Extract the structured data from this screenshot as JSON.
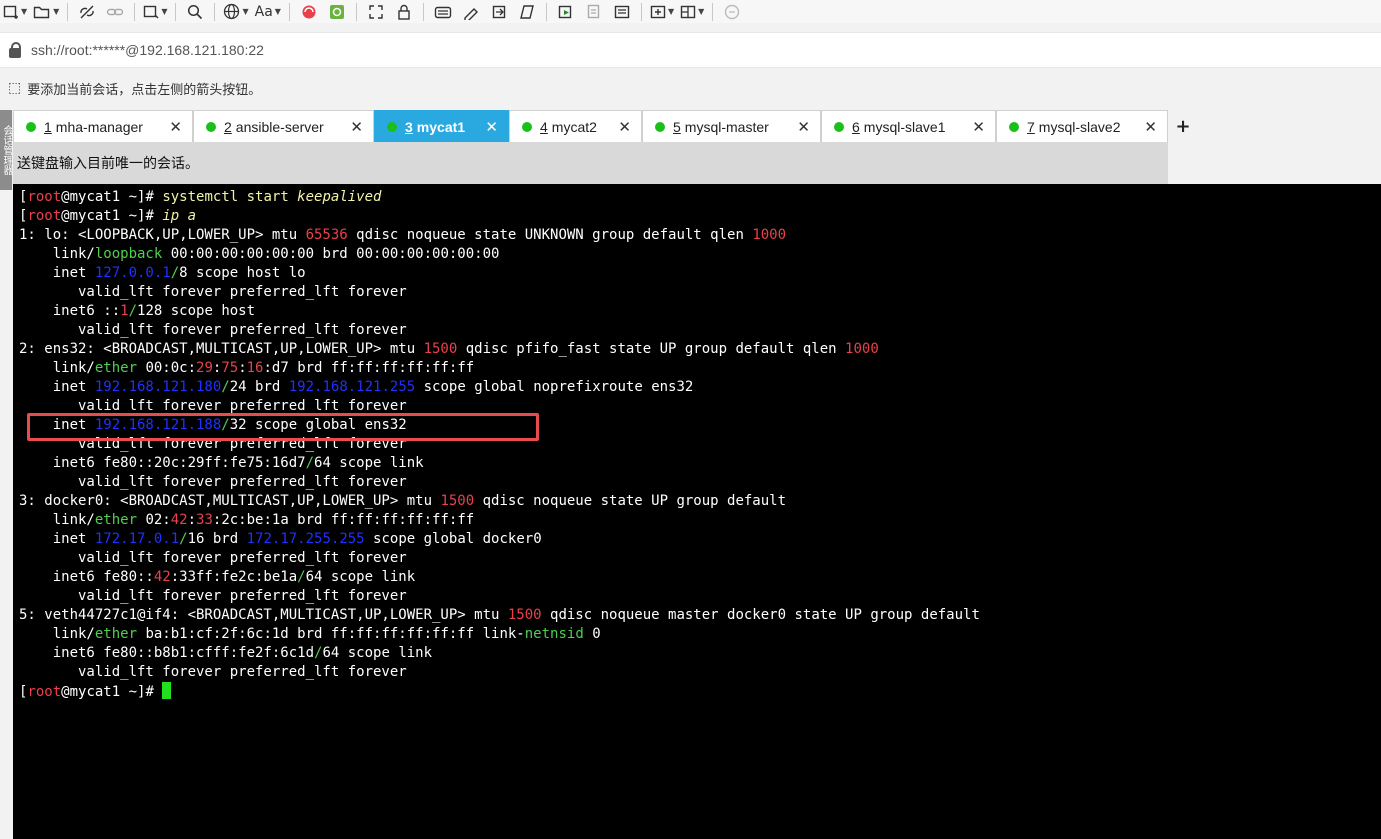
{
  "toolbar": {
    "icons": [
      "new-session-icon",
      "open-folder-icon",
      "disconnect-icon",
      "link-icon",
      "new-window-icon",
      "search-icon",
      "globe-icon",
      "font-icon",
      "app-red-icon",
      "app-green-icon",
      "fullscreen-icon",
      "lock-icon",
      "keyboard-icon",
      "script-icon",
      "transfer-icon",
      "macro-icon",
      "log-icon",
      "record-icon",
      "notes-icon",
      "add-icon",
      "layout-icon",
      "chat-icon"
    ],
    "font_label": "Aa"
  },
  "address": {
    "text": "ssh://root:******@192.168.121.180:22"
  },
  "hint": {
    "text": "要添加当前会话，点击左侧的箭头按钮。"
  },
  "sidebar": {
    "text": "会话管理器"
  },
  "tabs": [
    {
      "num": "1",
      "label": "mha-manager",
      "active": false
    },
    {
      "num": "2",
      "label": "ansible-server",
      "active": false
    },
    {
      "num": "3",
      "label": "mycat1",
      "active": true
    },
    {
      "num": "4",
      "label": "mycat2",
      "active": false
    },
    {
      "num": "5",
      "label": "mysql-master",
      "active": false
    },
    {
      "num": "6",
      "label": "mysql-slave1",
      "active": false
    },
    {
      "num": "7",
      "label": "mysql-slave2",
      "active": false
    }
  ],
  "tab_close": "✕",
  "tab_add": "+",
  "notice": {
    "text": "送键盘输入目前唯一的会话。"
  },
  "terminal": {
    "lines": [
      [
        [
          "[",
          ""
        ],
        [
          "root",
          "r"
        ],
        [
          "@mycat1 ~]# ",
          ""
        ],
        [
          "systemctl start ",
          "y"
        ],
        [
          "keepalived",
          "y i"
        ]
      ],
      [
        [
          "[",
          ""
        ],
        [
          "root",
          "r"
        ],
        [
          "@mycat1 ~]# ",
          ""
        ],
        [
          "ip a",
          "y i"
        ]
      ],
      [
        [
          "1: lo: <LOOPBACK,UP,LOWER_UP> mtu ",
          ""
        ],
        [
          "65536",
          "r"
        ],
        [
          " qdisc noqueue state UNKNOWN group default qlen ",
          ""
        ],
        [
          "1000",
          "r"
        ]
      ],
      [
        [
          "    link/",
          ""
        ],
        [
          "loopback",
          "g"
        ],
        [
          " 00:00:00:00:00:00 brd 00:00:00:00:00:00",
          ""
        ]
      ],
      [
        [
          "    inet ",
          ""
        ],
        [
          "127.0.0.1",
          "b"
        ],
        [
          "/",
          "g"
        ],
        [
          "8",
          ""
        ],
        [
          " scope host lo",
          ""
        ]
      ],
      [
        [
          "       valid_lft forever preferred_lft forever",
          ""
        ]
      ],
      [
        [
          "    inet6 ::",
          ""
        ],
        [
          "1",
          "r"
        ],
        [
          "/",
          "g"
        ],
        [
          "128",
          ""
        ],
        [
          " scope host",
          ""
        ]
      ],
      [
        [
          "       valid_lft forever preferred_lft forever",
          ""
        ]
      ],
      [
        [
          "2: ens32: <BROADCAST,MULTICAST,UP,LOWER_UP> mtu ",
          ""
        ],
        [
          "1500",
          "r"
        ],
        [
          " qdisc pfifo_fast state UP group default qlen ",
          ""
        ],
        [
          "1000",
          "r"
        ]
      ],
      [
        [
          "    link/",
          ""
        ],
        [
          "ether",
          "g"
        ],
        [
          " 00:0c:",
          ""
        ],
        [
          "29",
          "r"
        ],
        [
          ":",
          ""
        ],
        [
          "75",
          "r"
        ],
        [
          ":",
          ""
        ],
        [
          "16",
          "r"
        ],
        [
          ":d7 brd ff:ff:ff:ff:ff:ff",
          ""
        ]
      ],
      [
        [
          "    inet ",
          ""
        ],
        [
          "192.168.121.180",
          "b"
        ],
        [
          "/",
          "g"
        ],
        [
          "24",
          ""
        ],
        [
          " brd ",
          ""
        ],
        [
          "192.168.121.255",
          "b"
        ],
        [
          " scope global noprefixroute ens32",
          ""
        ]
      ],
      [
        [
          "       valid_lft forever preferred_lft forever",
          ""
        ]
      ],
      [
        [
          "    inet ",
          ""
        ],
        [
          "192.168.121.188",
          "b"
        ],
        [
          "/",
          "g"
        ],
        [
          "32",
          ""
        ],
        [
          " scope global ens32",
          ""
        ]
      ],
      [
        [
          "       valid_lft forever preferred_lft forever",
          ""
        ]
      ],
      [
        [
          "    inet6 fe80::20c:29ff:fe75:16d7",
          ""
        ],
        [
          "/",
          "g"
        ],
        [
          "64",
          ""
        ],
        [
          " scope link",
          ""
        ]
      ],
      [
        [
          "       valid_lft forever preferred_lft forever",
          ""
        ]
      ],
      [
        [
          "3: docker0: <BROADCAST,MULTICAST,UP,LOWER_UP> mtu ",
          ""
        ],
        [
          "1500",
          "r"
        ],
        [
          " qdisc noqueue state UP group default",
          ""
        ]
      ],
      [
        [
          "    link/",
          ""
        ],
        [
          "ether",
          "g"
        ],
        [
          " 02:",
          ""
        ],
        [
          "42",
          "r"
        ],
        [
          ":",
          ""
        ],
        [
          "33",
          "r"
        ],
        [
          ":2c:be:1a brd ff:ff:ff:ff:ff:ff",
          ""
        ]
      ],
      [
        [
          "    inet ",
          ""
        ],
        [
          "172.17.0.1",
          "b"
        ],
        [
          "/",
          "g"
        ],
        [
          "16",
          ""
        ],
        [
          " brd ",
          ""
        ],
        [
          "172.17.255.255",
          "b"
        ],
        [
          " scope global docker0",
          ""
        ]
      ],
      [
        [
          "       valid_lft forever preferred_lft forever",
          ""
        ]
      ],
      [
        [
          "    inet6 fe80::",
          ""
        ],
        [
          "42",
          "r"
        ],
        [
          ":33ff:fe2c:be1a",
          ""
        ],
        [
          "/",
          "g"
        ],
        [
          "64",
          ""
        ],
        [
          " scope link",
          ""
        ]
      ],
      [
        [
          "       valid_lft forever preferred_lft forever",
          ""
        ]
      ],
      [
        [
          "5: veth44727c1@if4: <BROADCAST,MULTICAST,UP,LOWER_UP> mtu ",
          ""
        ],
        [
          "1500",
          "r"
        ],
        [
          " qdisc noqueue master docker0 state UP group default",
          ""
        ]
      ],
      [
        [
          "    link/",
          ""
        ],
        [
          "ether",
          "g"
        ],
        [
          " ba:b1:cf:2f:6c:1d brd ff:ff:ff:ff:ff:ff link-",
          ""
        ],
        [
          "netnsid",
          "g"
        ],
        [
          " 0",
          ""
        ]
      ],
      [
        [
          "    inet6 fe80::b8b1:cfff:fe2f:6c1d",
          ""
        ],
        [
          "/",
          "g"
        ],
        [
          "64",
          ""
        ],
        [
          " scope link",
          ""
        ]
      ],
      [
        [
          "       valid_lft forever preferred_lft forever",
          ""
        ]
      ],
      [
        [
          "[",
          ""
        ],
        [
          "root",
          "r"
        ],
        [
          "@mycat1 ~]# ",
          ""
        ]
      ]
    ]
  },
  "colors": {
    "tab_active": "#2aa9e0",
    "status_dot": "#1bbf1b",
    "highlight_box": "#e84c4c",
    "cursor": "#20e020"
  }
}
